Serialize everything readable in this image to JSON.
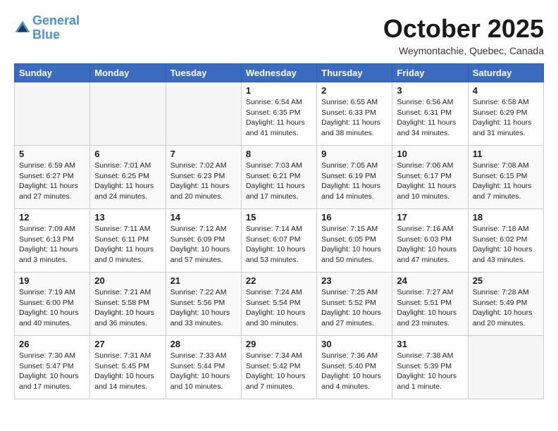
{
  "header": {
    "logo_line1": "General",
    "logo_line2": "Blue",
    "month_title": "October 2025",
    "location": "Weymontachie, Quebec, Canada"
  },
  "days_of_week": [
    "Sunday",
    "Monday",
    "Tuesday",
    "Wednesday",
    "Thursday",
    "Friday",
    "Saturday"
  ],
  "weeks": [
    [
      {
        "day": "",
        "info": ""
      },
      {
        "day": "",
        "info": ""
      },
      {
        "day": "",
        "info": ""
      },
      {
        "day": "1",
        "info": "Sunrise: 6:54 AM\nSunset: 6:35 PM\nDaylight: 11 hours\nand 41 minutes."
      },
      {
        "day": "2",
        "info": "Sunrise: 6:55 AM\nSunset: 6:33 PM\nDaylight: 11 hours\nand 38 minutes."
      },
      {
        "day": "3",
        "info": "Sunrise: 6:56 AM\nSunset: 6:31 PM\nDaylight: 11 hours\nand 34 minutes."
      },
      {
        "day": "4",
        "info": "Sunrise: 6:58 AM\nSunset: 6:29 PM\nDaylight: 11 hours\nand 31 minutes."
      }
    ],
    [
      {
        "day": "5",
        "info": "Sunrise: 6:59 AM\nSunset: 6:27 PM\nDaylight: 11 hours\nand 27 minutes."
      },
      {
        "day": "6",
        "info": "Sunrise: 7:01 AM\nSunset: 6:25 PM\nDaylight: 11 hours\nand 24 minutes."
      },
      {
        "day": "7",
        "info": "Sunrise: 7:02 AM\nSunset: 6:23 PM\nDaylight: 11 hours\nand 20 minutes."
      },
      {
        "day": "8",
        "info": "Sunrise: 7:03 AM\nSunset: 6:21 PM\nDaylight: 11 hours\nand 17 minutes."
      },
      {
        "day": "9",
        "info": "Sunrise: 7:05 AM\nSunset: 6:19 PM\nDaylight: 11 hours\nand 14 minutes."
      },
      {
        "day": "10",
        "info": "Sunrise: 7:06 AM\nSunset: 6:17 PM\nDaylight: 11 hours\nand 10 minutes."
      },
      {
        "day": "11",
        "info": "Sunrise: 7:08 AM\nSunset: 6:15 PM\nDaylight: 11 hours\nand 7 minutes."
      }
    ],
    [
      {
        "day": "12",
        "info": "Sunrise: 7:09 AM\nSunset: 6:13 PM\nDaylight: 11 hours\nand 3 minutes."
      },
      {
        "day": "13",
        "info": "Sunrise: 7:11 AM\nSunset: 6:11 PM\nDaylight: 11 hours\nand 0 minutes."
      },
      {
        "day": "14",
        "info": "Sunrise: 7:12 AM\nSunset: 6:09 PM\nDaylight: 10 hours\nand 57 minutes."
      },
      {
        "day": "15",
        "info": "Sunrise: 7:14 AM\nSunset: 6:07 PM\nDaylight: 10 hours\nand 53 minutes."
      },
      {
        "day": "16",
        "info": "Sunrise: 7:15 AM\nSunset: 6:05 PM\nDaylight: 10 hours\nand 50 minutes."
      },
      {
        "day": "17",
        "info": "Sunrise: 7:16 AM\nSunset: 6:03 PM\nDaylight: 10 hours\nand 47 minutes."
      },
      {
        "day": "18",
        "info": "Sunrise: 7:18 AM\nSunset: 6:02 PM\nDaylight: 10 hours\nand 43 minutes."
      }
    ],
    [
      {
        "day": "19",
        "info": "Sunrise: 7:19 AM\nSunset: 6:00 PM\nDaylight: 10 hours\nand 40 minutes."
      },
      {
        "day": "20",
        "info": "Sunrise: 7:21 AM\nSunset: 5:58 PM\nDaylight: 10 hours\nand 36 minutes."
      },
      {
        "day": "21",
        "info": "Sunrise: 7:22 AM\nSunset: 5:56 PM\nDaylight: 10 hours\nand 33 minutes."
      },
      {
        "day": "22",
        "info": "Sunrise: 7:24 AM\nSunset: 5:54 PM\nDaylight: 10 hours\nand 30 minutes."
      },
      {
        "day": "23",
        "info": "Sunrise: 7:25 AM\nSunset: 5:52 PM\nDaylight: 10 hours\nand 27 minutes."
      },
      {
        "day": "24",
        "info": "Sunrise: 7:27 AM\nSunset: 5:51 PM\nDaylight: 10 hours\nand 23 minutes."
      },
      {
        "day": "25",
        "info": "Sunrise: 7:28 AM\nSunset: 5:49 PM\nDaylight: 10 hours\nand 20 minutes."
      }
    ],
    [
      {
        "day": "26",
        "info": "Sunrise: 7:30 AM\nSunset: 5:47 PM\nDaylight: 10 hours\nand 17 minutes."
      },
      {
        "day": "27",
        "info": "Sunrise: 7:31 AM\nSunset: 5:45 PM\nDaylight: 10 hours\nand 14 minutes."
      },
      {
        "day": "28",
        "info": "Sunrise: 7:33 AM\nSunset: 5:44 PM\nDaylight: 10 hours\nand 10 minutes."
      },
      {
        "day": "29",
        "info": "Sunrise: 7:34 AM\nSunset: 5:42 PM\nDaylight: 10 hours\nand 7 minutes."
      },
      {
        "day": "30",
        "info": "Sunrise: 7:36 AM\nSunset: 5:40 PM\nDaylight: 10 hours\nand 4 minutes."
      },
      {
        "day": "31",
        "info": "Sunrise: 7:38 AM\nSunset: 5:39 PM\nDaylight: 10 hours\nand 1 minute."
      },
      {
        "day": "",
        "info": ""
      }
    ]
  ]
}
